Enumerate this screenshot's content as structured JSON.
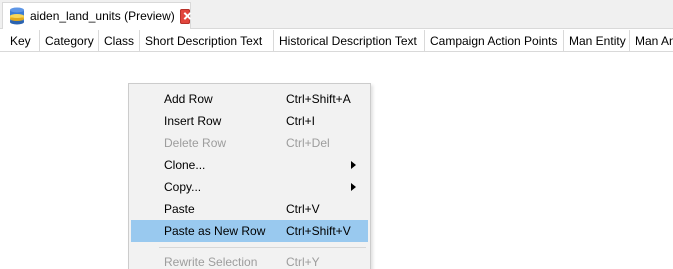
{
  "tab": {
    "label": "aiden_land_units (Preview)",
    "icon": "database-icon",
    "close_icon": "close-icon",
    "close_color": "#e2463d"
  },
  "table": {
    "columns": [
      "Key",
      "Category",
      "Class",
      "Short Description Text",
      "Historical Description Text",
      "Campaign Action Points",
      "Man Entity",
      "Man Ani"
    ]
  },
  "context_menu": {
    "items": [
      {
        "label": "Add Row",
        "shortcut": "Ctrl+Shift+A",
        "enabled": true
      },
      {
        "label": "Insert Row",
        "shortcut": "Ctrl+I",
        "enabled": true
      },
      {
        "label": "Delete Row",
        "shortcut": "Ctrl+Del",
        "enabled": false
      },
      {
        "label": "Clone...",
        "shortcut": "",
        "submenu": true,
        "enabled": true
      },
      {
        "label": "Copy...",
        "shortcut": "",
        "submenu": true,
        "enabled": true
      },
      {
        "label": "Paste",
        "shortcut": "Ctrl+V",
        "enabled": true
      },
      {
        "label": "Paste as New Row",
        "shortcut": "Ctrl+Shift+V",
        "enabled": true,
        "selected": true
      },
      {
        "label": "Rewrite Selection",
        "shortcut": "Ctrl+Y",
        "enabled": false
      }
    ],
    "highlight_color": "#99c9ef"
  }
}
